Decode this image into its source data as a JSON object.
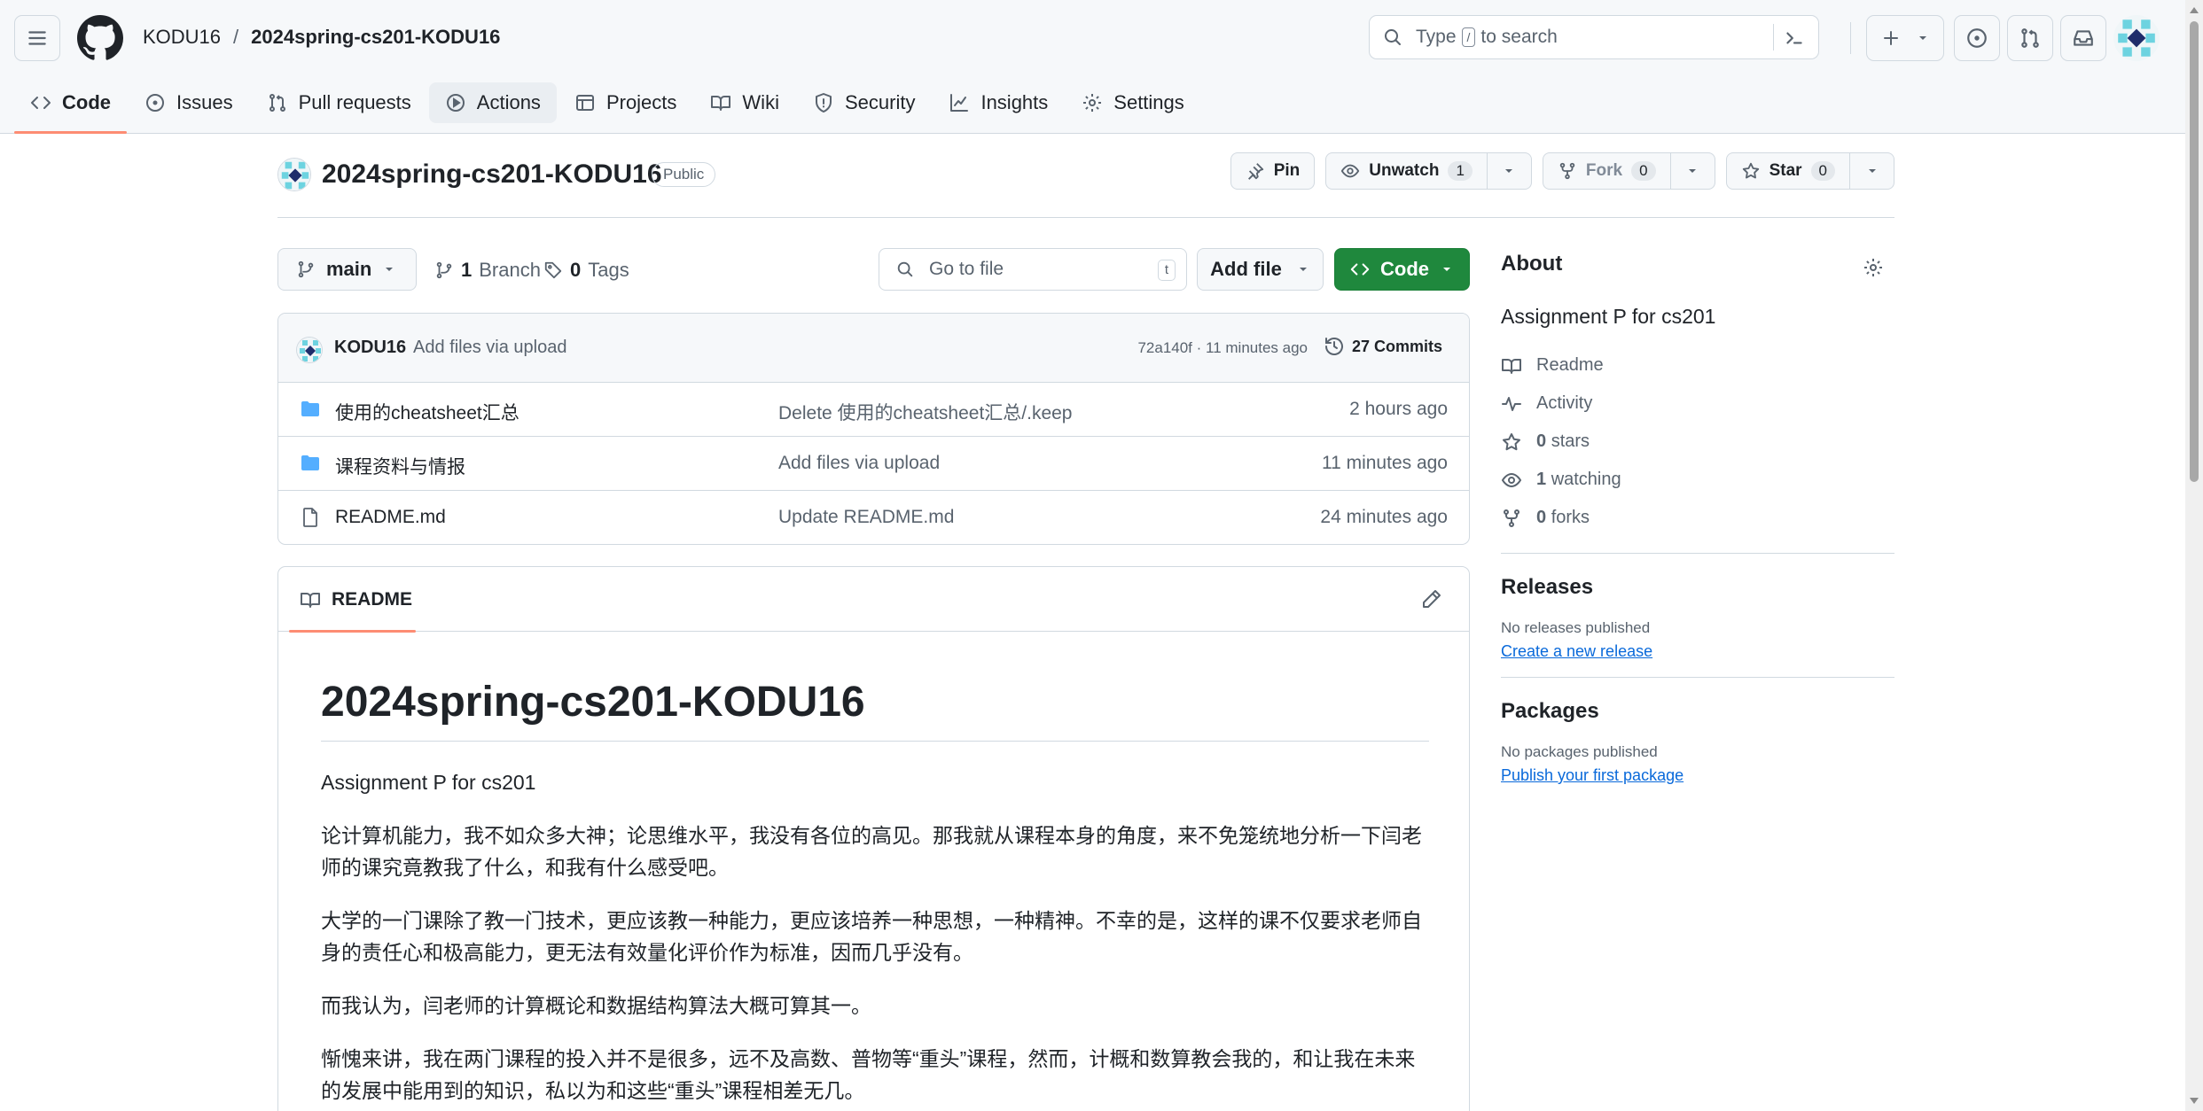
{
  "header": {
    "owner": "KODU16",
    "separator": "/",
    "repo": "2024spring-cs201-KODU16",
    "search": {
      "prefix": "Type",
      "key": "/",
      "suffix": "to search"
    }
  },
  "tabs": [
    {
      "label": "Code"
    },
    {
      "label": "Issues"
    },
    {
      "label": "Pull requests"
    },
    {
      "label": "Actions"
    },
    {
      "label": "Projects"
    },
    {
      "label": "Wiki"
    },
    {
      "label": "Security"
    },
    {
      "label": "Insights"
    },
    {
      "label": "Settings"
    }
  ],
  "repo": {
    "name": "2024spring-cs201-KODU16",
    "visibility": "Public",
    "actions": {
      "pin": "Pin",
      "unwatch": "Unwatch",
      "watch_count": "1",
      "fork": "Fork",
      "fork_count": "0",
      "star": "Star",
      "star_count": "0"
    }
  },
  "toolbar": {
    "branch": "main",
    "branches_count": "1",
    "branches_label": "Branch",
    "tags_count": "0",
    "tags_label": "Tags",
    "goto_placeholder": "Go to file",
    "goto_key": "t",
    "add_file": "Add file",
    "code": "Code"
  },
  "commit": {
    "author": "KODU16",
    "message": "Add files via upload",
    "meta": "72a140f · 11 minutes ago",
    "commits_label": "27 Commits"
  },
  "files": [
    {
      "name": "使用的cheatsheet汇总",
      "type": "folder",
      "message": "Delete 使用的cheatsheet汇总/.keep",
      "age": "2 hours ago"
    },
    {
      "name": "课程资料与情报",
      "type": "folder",
      "message": "Add files via upload",
      "age": "11 minutes ago"
    },
    {
      "name": "README.md",
      "type": "file",
      "message": "Update README.md",
      "age": "24 minutes ago"
    }
  ],
  "readme": {
    "tab_label": "README",
    "title": "2024spring-cs201-KODU16",
    "paragraphs": [
      "Assignment P for cs201",
      "论计算机能力，我不如众多大神；论思维水平，我没有各位的高见。那我就从课程本身的角度，来不免笼统地分析一下闫老师的课究竟教我了什么，和我有什么感受吧。",
      "大学的一门课除了教一门技术，更应该教一种能力，更应该培养一种思想，一种精神。不幸的是，这样的课不仅要求老师自身的责任心和极高能力，更无法有效量化评价作为标准，因而几乎没有。",
      "而我认为，闫老师的计算概论和数据结构算法大概可算其一。",
      "惭愧来讲，我在两门课程的投入并不是很多，远不及高数、普物等“重头”课程，然而，计概和数算教会我的，和让我在未来的发展中能用到的知识，私以为和这些“重头”课程相差无几。"
    ]
  },
  "about": {
    "title": "About",
    "description": "Assignment P for cs201",
    "readme": "Readme",
    "activity": "Activity",
    "stars_count": "0",
    "stars_label": "stars",
    "watching_count": "1",
    "watching_label": "watching",
    "forks_count": "0",
    "forks_label": "forks"
  },
  "releases": {
    "title": "Releases",
    "empty": "No releases published",
    "link": "Create a new release"
  },
  "packages": {
    "title": "Packages",
    "empty": "No packages published",
    "link": "Publish your first package"
  },
  "colors": {
    "accent_green": "#1f883d",
    "tab_underline": "#fd8c73",
    "link_blue": "#0969da",
    "folder_blue": "#54aeff"
  },
  "icons": {
    "menu": "hamburger-icon",
    "logo": "github-mark-icon",
    "folder": "folder-icon",
    "file": "file-icon"
  }
}
